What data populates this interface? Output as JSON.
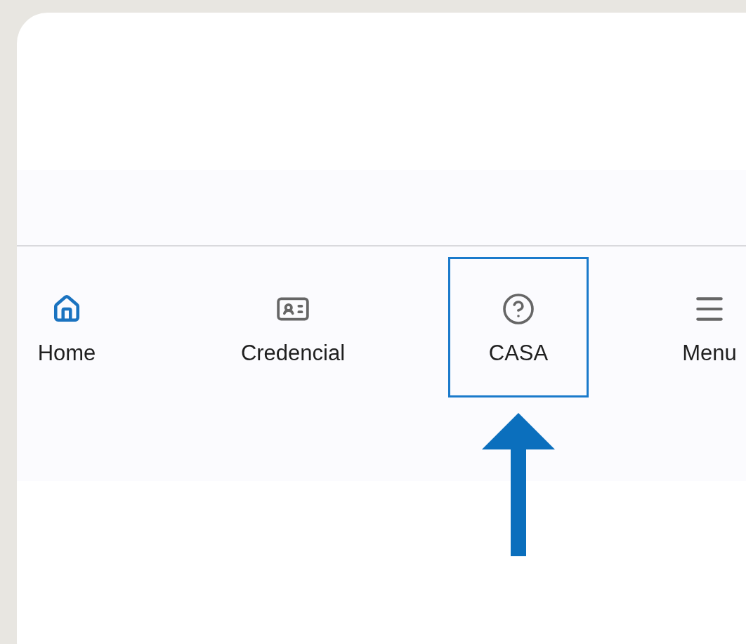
{
  "bottom_nav": [
    {
      "kind": "home",
      "label": "Home",
      "selected": true,
      "highlighted": false
    },
    {
      "kind": "credential",
      "label": "Credencial",
      "selected": false,
      "highlighted": false
    },
    {
      "kind": "help",
      "label": "CASA",
      "selected": false,
      "highlighted": true
    },
    {
      "kind": "menu",
      "label": "Menu",
      "selected": false,
      "highlighted": false
    }
  ]
}
